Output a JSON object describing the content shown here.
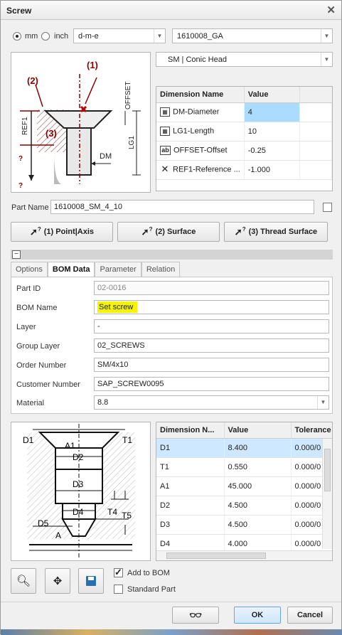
{
  "window": {
    "title": "Screw"
  },
  "units": {
    "mm_label": "mm",
    "inch_label": "inch",
    "selected": "mm"
  },
  "combos": {
    "standard": "d-m-e",
    "part": "1610008_GA",
    "head": "SM | Conic Head"
  },
  "diagram1": {
    "callout1": "(1)",
    "callout2": "(2)",
    "callout3": "(3)",
    "offset": "OFFSET",
    "ref1": "REF1",
    "lg1": "LG1",
    "dm": "DM",
    "q": "?"
  },
  "dim_table": {
    "headers": [
      "Dimension Name",
      "Value"
    ],
    "rows": [
      {
        "icon": "table-icon",
        "name": "DM-Diameter",
        "value": "4"
      },
      {
        "icon": "table-icon",
        "name": "LG1-Length",
        "value": "10"
      },
      {
        "icon": "ab-icon",
        "name": "OFFSET-Offset",
        "value": "-0.25"
      },
      {
        "icon": "cross-icon",
        "name": "REF1-Reference ...",
        "value": "-1.000"
      }
    ]
  },
  "part_name": {
    "label": "Part Name",
    "value": "1610008_SM_4_10"
  },
  "ref_buttons": [
    "(1) Point|Axis",
    "(2) Surface",
    "(3) Thread Surface"
  ],
  "tabs": [
    "Options",
    "BOM Data",
    "Parameter",
    "Relation"
  ],
  "active_tab": "BOM Data",
  "bom": {
    "part_id": {
      "label": "Part ID",
      "value": "02-0016"
    },
    "bom_name": {
      "label": "BOM Name",
      "value": "Set screw"
    },
    "layer": {
      "label": "Layer",
      "value": "-"
    },
    "group_layer": {
      "label": "Group Layer",
      "value": "02_SCREWS"
    },
    "order_number": {
      "label": "Order Number",
      "value": "SM/4x10"
    },
    "customer_number": {
      "label": "Customer Number",
      "value": "SAP_SCREW0095"
    },
    "material": {
      "label": "Material",
      "value": "8.8"
    }
  },
  "diagram2": {
    "d1": "D1",
    "a1": "A1",
    "t1": "T1",
    "d2": "D2",
    "d3": "D3",
    "d4": "D4",
    "t4": "T4",
    "t5": "T5",
    "d5": "D5",
    "a": "A"
  },
  "tol_table": {
    "headers": [
      "Dimension N...",
      "Value",
      "Tolerance"
    ],
    "rows": [
      {
        "name": "D1",
        "value": "8.400",
        "tol": "0.000/0"
      },
      {
        "name": "T1",
        "value": "0.550",
        "tol": "0.000/0"
      },
      {
        "name": "A1",
        "value": "45.000",
        "tol": "0.000/0"
      },
      {
        "name": "D2",
        "value": "4.500",
        "tol": "0.000/0"
      },
      {
        "name": "D3",
        "value": "4.500",
        "tol": "0.000/0"
      },
      {
        "name": "D4",
        "value": "4.000",
        "tol": "0.000/0"
      }
    ]
  },
  "checks": {
    "add_to_bom": "Add to BOM",
    "standard_part": "Standard Part"
  },
  "footer": {
    "ok": "OK",
    "cancel": "Cancel"
  },
  "colors": {
    "highlight": "#f5f500",
    "selected_row": "#cde8ff",
    "diagram_red": "#8b0000"
  }
}
